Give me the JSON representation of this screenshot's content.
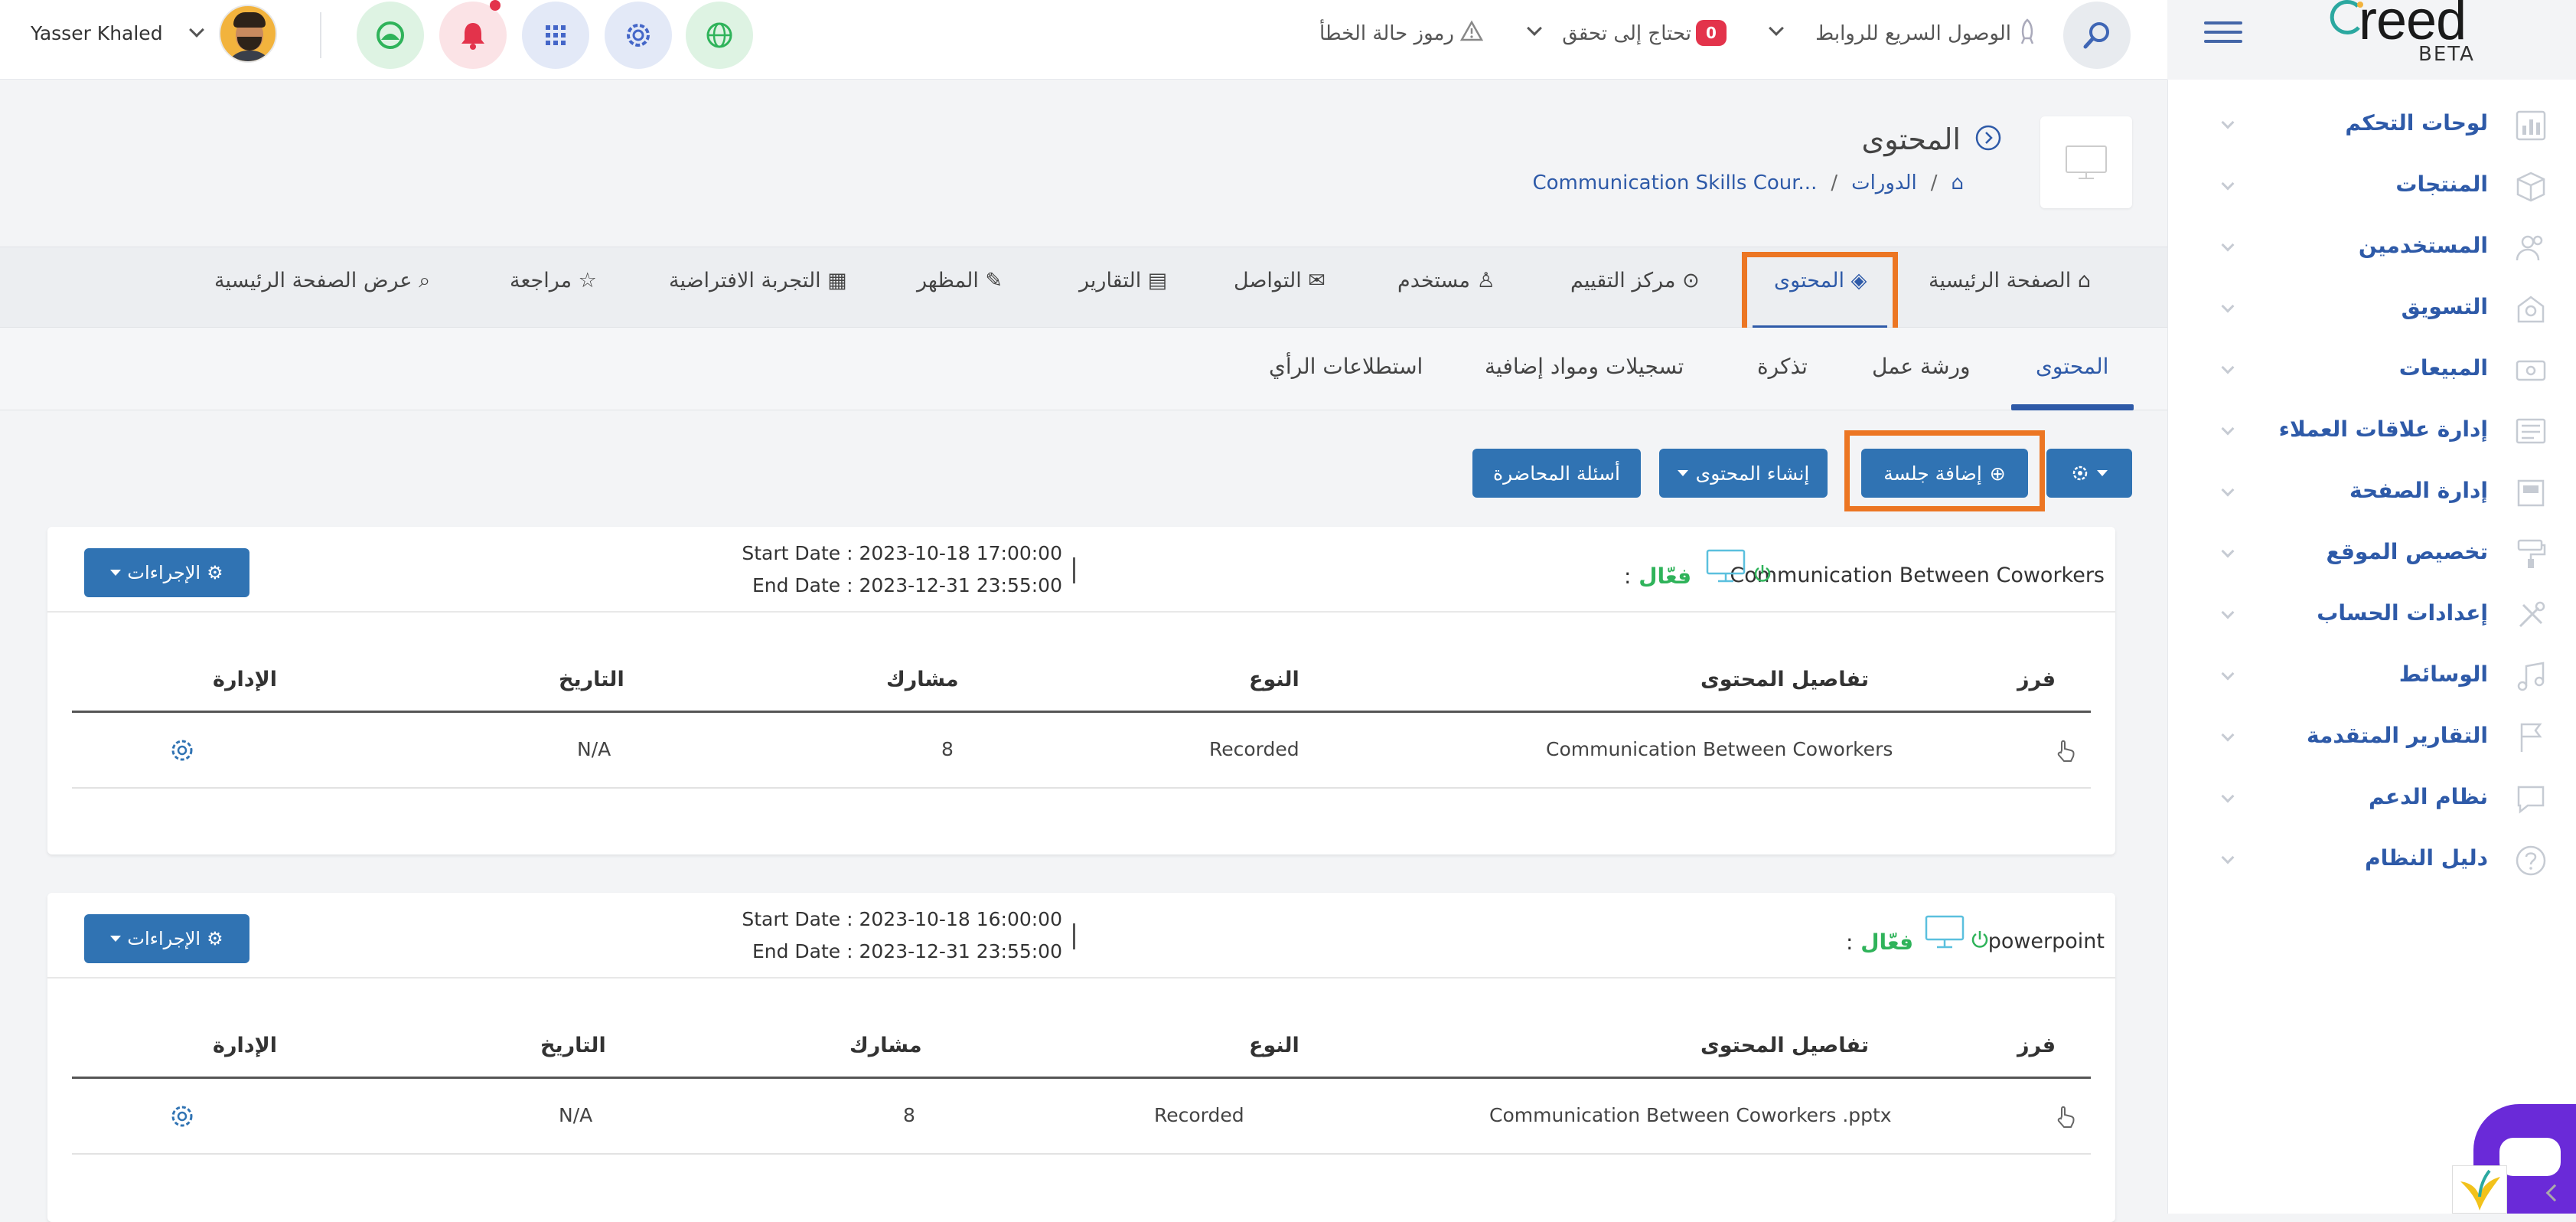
{
  "header": {
    "user_name": "Yasser Khaled",
    "error_codes": "رموز حالة الخطأ",
    "needs_check": "تحتاج إلى تحقق",
    "needs_check_count": "0",
    "quick_access": "الوصول السريع للروابط"
  },
  "logo": {
    "word": "reed",
    "beta": "BETA"
  },
  "sidebar": {
    "items": [
      {
        "label": "لوحات التحكم",
        "icon": "dashboard-icon"
      },
      {
        "label": "المنتجات",
        "icon": "box-icon"
      },
      {
        "label": "المستخدمين",
        "icon": "users-icon"
      },
      {
        "label": "التسويق",
        "icon": "marketing-icon"
      },
      {
        "label": "المبيعات",
        "icon": "sales-icon"
      },
      {
        "label": "إدارة علاقات العملاء",
        "icon": "crm-icon"
      },
      {
        "label": "إدارة الصفحة",
        "icon": "page-icon"
      },
      {
        "label": "تخصيص الموقع",
        "icon": "paint-roller-icon"
      },
      {
        "label": "إعدادات الحساب",
        "icon": "tools-icon"
      },
      {
        "label": "الوسائط",
        "icon": "music-icon"
      },
      {
        "label": "التقارير المتقدمة",
        "icon": "flag-icon"
      },
      {
        "label": "نظام الدعم",
        "icon": "chat-icon"
      },
      {
        "label": "دليل النظام",
        "icon": "help-icon"
      }
    ]
  },
  "page": {
    "title": "المحتوى",
    "breadcrumb_courses": "الدورات",
    "breadcrumb_course": "Communication Skills Cour..."
  },
  "tabs": [
    {
      "label": "الصفحة الرئيسية"
    },
    {
      "label": "المحتوى"
    },
    {
      "label": "مركز التقييم"
    },
    {
      "label": "مستخدم"
    },
    {
      "label": "التواصل"
    },
    {
      "label": "التقارير"
    },
    {
      "label": "المظهر"
    },
    {
      "label": "التجربة الافتراضية"
    },
    {
      "label": "مراجعة"
    },
    {
      "label": "عرض الصفحة الرئيسية"
    }
  ],
  "subtabs": [
    {
      "label": "المحتوى"
    },
    {
      "label": "ورشة عمل"
    },
    {
      "label": "تذكرة"
    },
    {
      "label": "تسجيلات ومواد إضافية"
    },
    {
      "label": "استطلاعات الرأي"
    }
  ],
  "actions": {
    "add_session": "إضافة جلسة",
    "create_content": "إنشاء المحتوى",
    "lecture_questions": "أسئلة المحاضرة"
  },
  "table_headers": {
    "sort": "فرز",
    "details": "تفاصيل المحتوى",
    "type": "النوع",
    "participant": "مشارك",
    "date": "التاريخ",
    "admin": "الإدارة"
  },
  "cards": [
    {
      "title": "Communication Between Coworkers",
      "status": "فعّال",
      "status_sep": ":",
      "start_date": "Start Date : 2023-10-18 17:00:00",
      "end_date": "End Date : 2023-12-31 23:55:00",
      "actions_label": "الإجراءات",
      "row": {
        "details": "Communication Between Coworkers",
        "type": "Recorded",
        "participant": "8",
        "date": "N/A"
      }
    },
    {
      "title": "powerpoint",
      "status": "فعّال",
      "status_sep": ":",
      "start_date": "Start Date : 2023-10-18 16:00:00",
      "end_date": "End Date : 2023-12-31 23:55:00",
      "actions_label": "الإجراءات",
      "row": {
        "details": "Communication Between Coworkers .pptx",
        "type": "Recorded",
        "participant": "8",
        "date": "N/A"
      }
    }
  ],
  "colors": {
    "primary": "#3073b3",
    "highlight": "#ec7623",
    "active_status": "#2fb35a",
    "sidebar_text": "#2e5aa8"
  }
}
